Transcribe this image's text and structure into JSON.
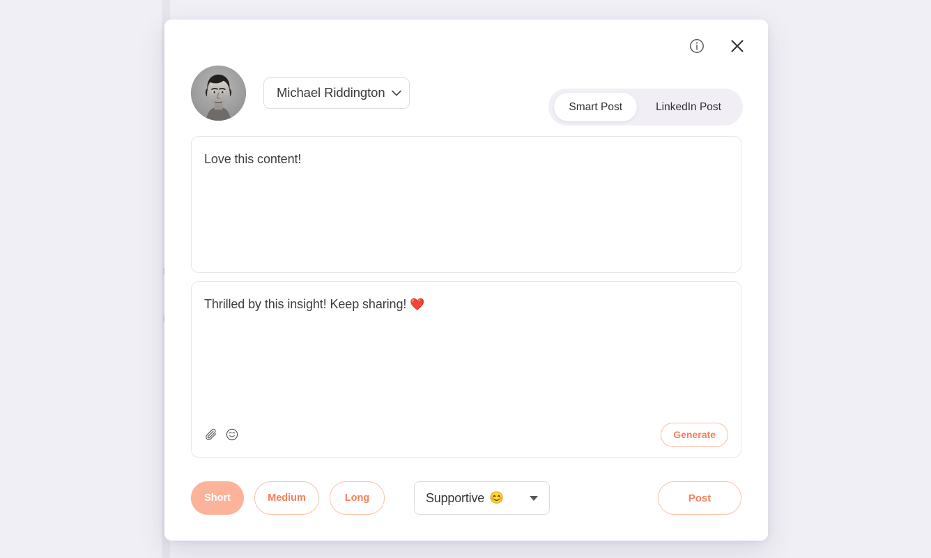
{
  "background": {
    "page_color": "#f0eff5"
  },
  "modal": {
    "topbar": {
      "info_icon": "info-circle-icon",
      "close_icon": "close-x-icon"
    },
    "header": {
      "avatar_alt": "user-avatar-photo",
      "account_name": "Michael Riddington",
      "account_chevron": "chevron-down-icon"
    },
    "mode_toggle": {
      "options": [
        {
          "label": "Smart Post",
          "active": true
        },
        {
          "label": "LinkedIn Post",
          "active": false
        }
      ]
    },
    "source_box": {
      "text": "Love this content!"
    },
    "compose_box": {
      "text": "Thrilled by this insight! Keep sharing!",
      "trailing_emoji": "❤️",
      "attach_icon": "paperclip-icon",
      "emoji_icon": "smiley-face-icon",
      "generate_label": "Generate"
    },
    "footer": {
      "length_options": [
        {
          "label": "Short",
          "active": true
        },
        {
          "label": "Medium",
          "active": false
        },
        {
          "label": "Long",
          "active": false
        }
      ],
      "tone": {
        "label": "Supportive",
        "emoji": "😊",
        "caret_icon": "caret-down-icon"
      },
      "post_label": "Post"
    }
  },
  "colors": {
    "accent": "#fa7f58",
    "accent_fill": "#fbb49a",
    "accent_border": "#fcc0ab",
    "heart_red": "#f2433f",
    "toggle_track": "#f1eff5",
    "border_grey": "#e6e5e9"
  }
}
